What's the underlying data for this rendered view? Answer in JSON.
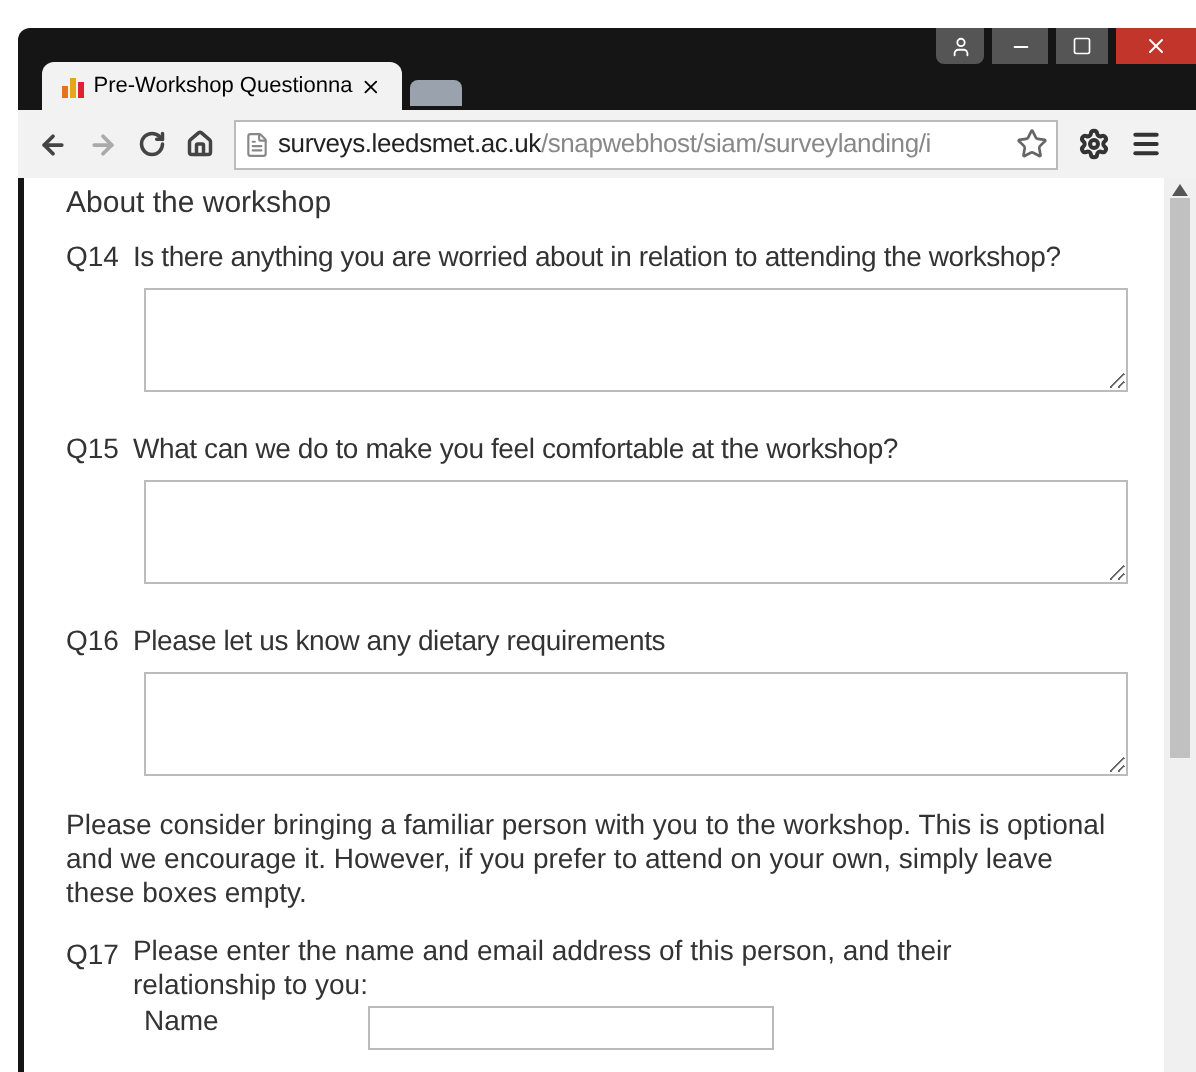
{
  "browser": {
    "tabs": [
      {
        "title": "Pre-Workshop Questionna",
        "selected": true
      },
      {
        "selected": false
      }
    ],
    "url_host": "surveys.leedsmet.ac.uk",
    "url_path": "/snapwebhost/siam/surveylanding/i"
  },
  "section_title": "About the workshop",
  "questions": [
    {
      "number": "Q14",
      "text": "Is there anything you are worried about in relation to attending the workshop?"
    },
    {
      "number": "Q15",
      "text": "What can we do to make you feel comfortable at the workshop?"
    },
    {
      "number": "Q16",
      "text": "Please let us know any dietary requirements"
    }
  ],
  "note": "Please consider bringing a familiar person with you to the workshop. This is optional and we encourage it. However, if you prefer to attend on your own, simply leave these boxes empty.",
  "q17": {
    "number": "Q17",
    "text": "Please enter the name and email address of this person, and their relationship to you:",
    "field_label": "Name"
  }
}
